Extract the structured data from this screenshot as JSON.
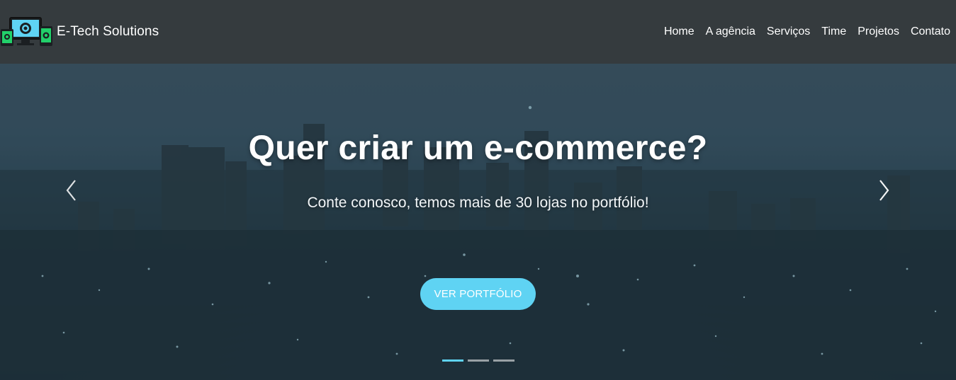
{
  "navbar": {
    "brand_name": "E-Tech Solutions",
    "links": [
      "Home",
      "A agência",
      "Serviços",
      "Time",
      "Projetos",
      "Contato"
    ]
  },
  "hero": {
    "title": "Quer criar um e-commerce?",
    "subtitle": "Conte conosco, temos mais de 30 lojas no portfólio!",
    "cta_label": "VER PORTFÓLIO",
    "prev_icon": "chevron-left-icon",
    "next_icon": "chevron-right-icon",
    "slide_count": 3,
    "active_slide": 1
  },
  "colors": {
    "navbar_bg": "#353b3e",
    "accent": "#5fd3f3",
    "text": "#ffffff"
  }
}
